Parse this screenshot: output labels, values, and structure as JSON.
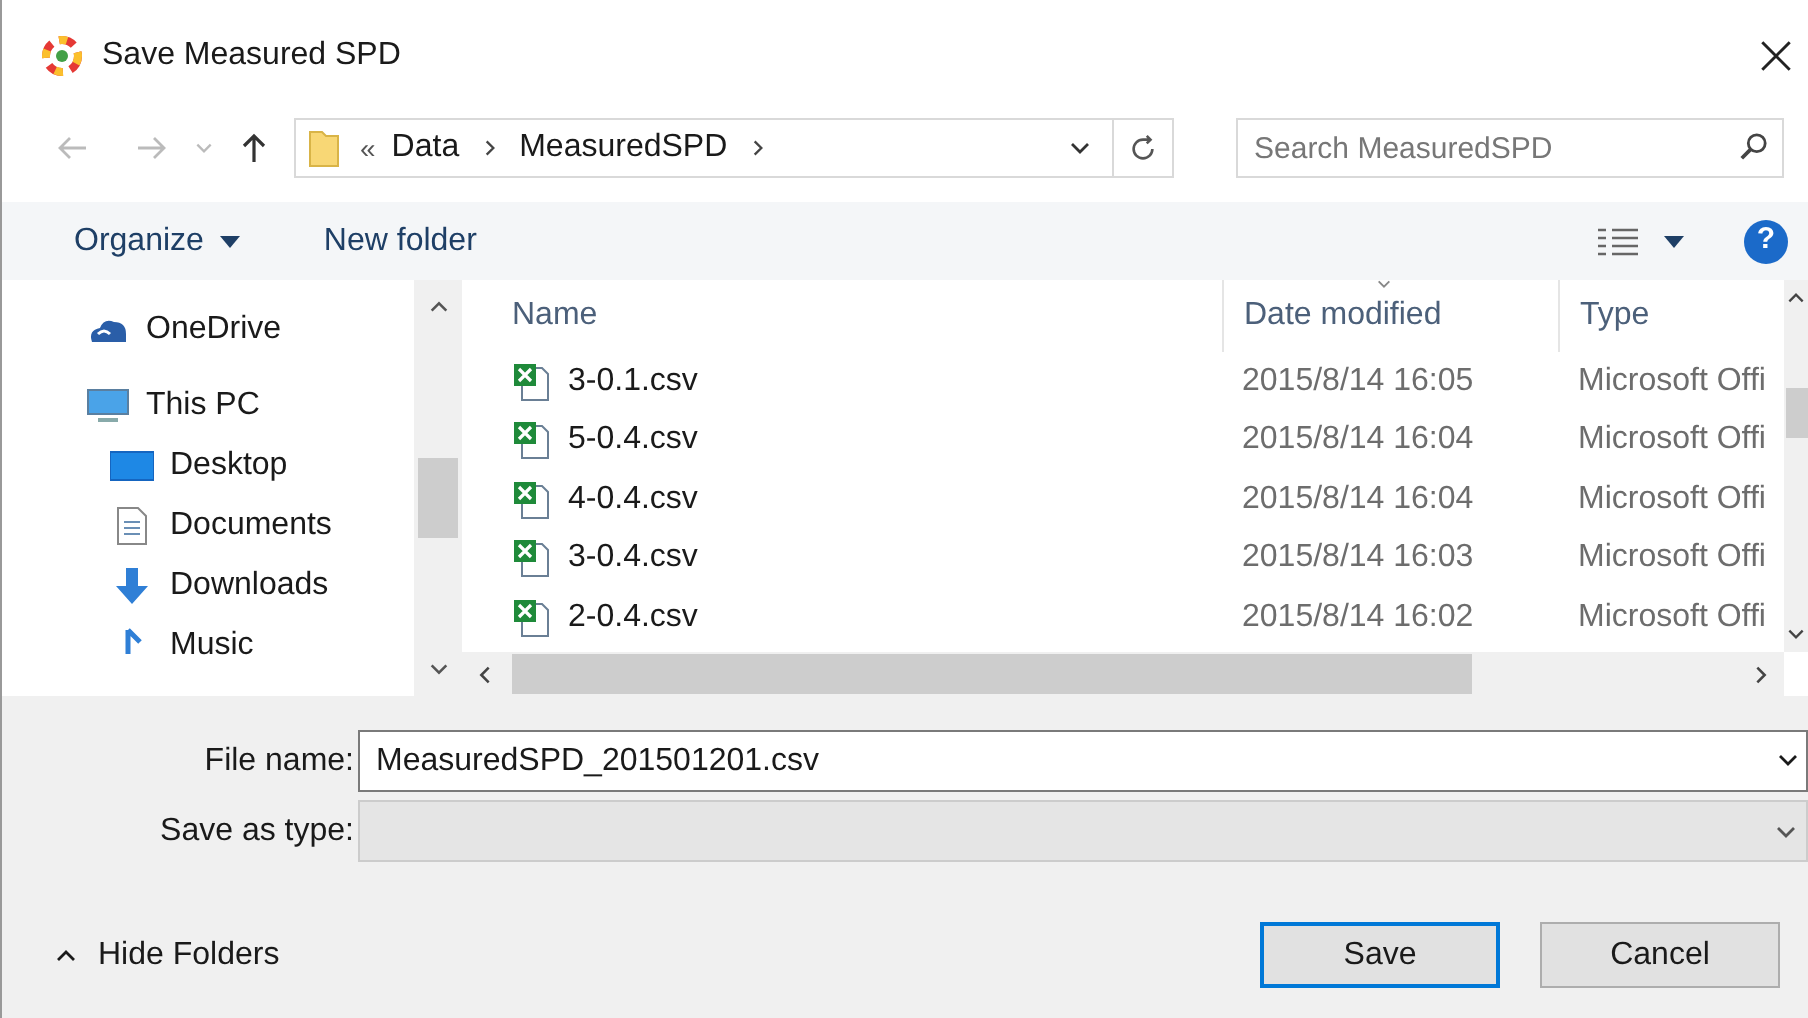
{
  "window": {
    "title": "Save Measured SPD"
  },
  "address": {
    "overflow": "«",
    "crumbs": [
      "Data",
      "MeasuredSPD"
    ],
    "search_placeholder": "Search MeasuredSPD"
  },
  "toolbar": {
    "organize": "Organize",
    "new_folder": "New folder",
    "help": "?"
  },
  "sidebar": {
    "items": [
      {
        "label": "OneDrive",
        "kind": "cloud"
      },
      {
        "label": "This PC",
        "kind": "pc",
        "children": [
          {
            "label": "Desktop",
            "kind": "desktop"
          },
          {
            "label": "Documents",
            "kind": "documents"
          },
          {
            "label": "Downloads",
            "kind": "downloads"
          },
          {
            "label": "Music",
            "kind": "music"
          }
        ]
      }
    ]
  },
  "table": {
    "columns": [
      "Name",
      "Date modified",
      "Type"
    ],
    "rows": [
      {
        "name": "3-0.1.csv",
        "date": "2015/8/14 16:05",
        "type": "Microsoft Offi"
      },
      {
        "name": "5-0.4.csv",
        "date": "2015/8/14 16:04",
        "type": "Microsoft Offi"
      },
      {
        "name": "4-0.4.csv",
        "date": "2015/8/14 16:04",
        "type": "Microsoft Offi"
      },
      {
        "name": "3-0.4.csv",
        "date": "2015/8/14 16:03",
        "type": "Microsoft Offi"
      },
      {
        "name": "2-0.4.csv",
        "date": "2015/8/14 16:02",
        "type": "Microsoft Offi"
      }
    ]
  },
  "form": {
    "file_name_label": "File name:",
    "file_name": "MeasuredSPD_201501201.csv",
    "type_label": "Save as type:"
  },
  "footer": {
    "hide_folders": "Hide Folders",
    "save": "Save",
    "cancel": "Cancel"
  }
}
